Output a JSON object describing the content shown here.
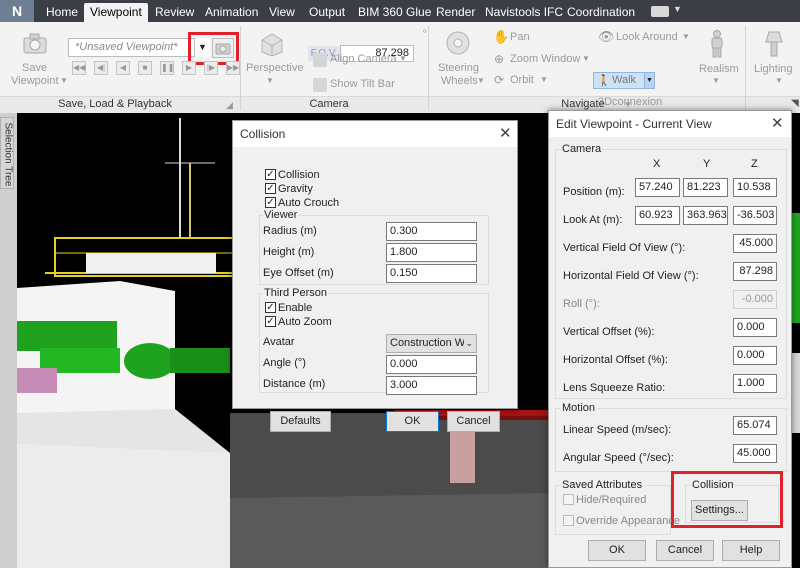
{
  "app": {
    "logo_letter": "N"
  },
  "tabs": [
    {
      "label": "Home"
    },
    {
      "label": "Viewpoint",
      "active": true
    },
    {
      "label": "Review"
    },
    {
      "label": "Animation"
    },
    {
      "label": "View"
    },
    {
      "label": "Output"
    },
    {
      "label": "BIM 360 Glue"
    },
    {
      "label": "Render"
    },
    {
      "label": "Navistools IFC"
    },
    {
      "label": "Coordination"
    }
  ],
  "ribbon": {
    "save_load": {
      "save_label_line1": "Save",
      "save_label_line2": "Viewpoint",
      "combo_value": "*Unsaved Viewpoint*",
      "panel_title": "Save, Load & Playback"
    },
    "camera": {
      "perspective_label": "Perspective",
      "fov_label": "F.O.V.",
      "fov_value": "87.298",
      "align_camera_label": "Align Camera",
      "show_tilt_bar_label": "Show Tilt Bar",
      "panel_title": "Camera"
    },
    "navigate": {
      "steering_line1": "Steering",
      "steering_line2": "Wheels",
      "pan_label": "Pan",
      "zoom_window_label": "Zoom Window",
      "orbit_label": "Orbit",
      "look_around_label": "Look Around",
      "walk_label": "Walk",
      "connexion_label": "3Dconnexion",
      "realism_label": "Realism",
      "panel_title": "Navigate"
    },
    "render_style": {
      "lighting_label": "Lighting"
    }
  },
  "sidebar": {
    "selection_tree_label": "Selection Tree"
  },
  "collision_dialog": {
    "title": "Collision",
    "collision_label": "Collision",
    "gravity_label": "Gravity",
    "auto_crouch_label": "Auto Crouch",
    "viewer_group": "Viewer",
    "radius_label": "Radius (m)",
    "radius_value": "0.300",
    "height_label": "Height (m)",
    "height_value": "1.800",
    "eye_offset_label": "Eye Offset (m)",
    "eye_offset_value": "0.150",
    "third_person_group": "Third Person",
    "enable_label": "Enable",
    "auto_zoom_label": "Auto Zoom",
    "avatar_label": "Avatar",
    "avatar_value": "Construction Work",
    "angle_label": "Angle (°)",
    "angle_value": "0.000",
    "distance_label": "Distance (m)",
    "distance_value": "3.000",
    "defaults_button": "Defaults",
    "ok_button": "OK",
    "cancel_button": "Cancel"
  },
  "edit_viewpoint_dialog": {
    "title": "Edit Viewpoint - Current View",
    "camera_group": "Camera",
    "col_x": "X",
    "col_y": "Y",
    "col_z": "Z",
    "position_label": "Position (m):",
    "position_x": "57.240",
    "position_y": "81.223",
    "position_z": "10.538",
    "look_at_label": "Look At (m):",
    "look_at_x": "60.923",
    "look_at_y": "363.963",
    "look_at_z": "-36.503",
    "vfov_label": "Vertical Field Of View (°):",
    "vfov_value": "45.000",
    "hfov_label": "Horizontal Field Of View (°):",
    "hfov_value": "87.298",
    "roll_label": "Roll (°):",
    "roll_value": "-0.000",
    "voffset_label": "Vertical Offset (%):",
    "voffset_value": "0.000",
    "hoffset_label": "Horizontal Offset (%):",
    "hoffset_value": "0.000",
    "lens_label": "Lens Squeeze Ratio:",
    "lens_value": "1.000",
    "motion_group": "Motion",
    "linear_label": "Linear Speed (m/sec):",
    "linear_value": "65.074",
    "angular_label": "Angular Speed (°/sec):",
    "angular_value": "45.000",
    "saved_attr_group": "Saved Attributes",
    "hide_required_label": "Hide/Required",
    "override_label": "Override Appearance",
    "collision_group": "Collision",
    "settings_button": "Settings...",
    "ok_button": "OK",
    "cancel_button": "Cancel",
    "help_button": "Help"
  },
  "colors": {
    "tabbar_bg": "#3b3e44",
    "ribbon_bg": "#f3f3f3",
    "highlight_red": "#e0212b",
    "scene_green": "#1fa31f",
    "scene_yellow": "#e5d21a"
  }
}
